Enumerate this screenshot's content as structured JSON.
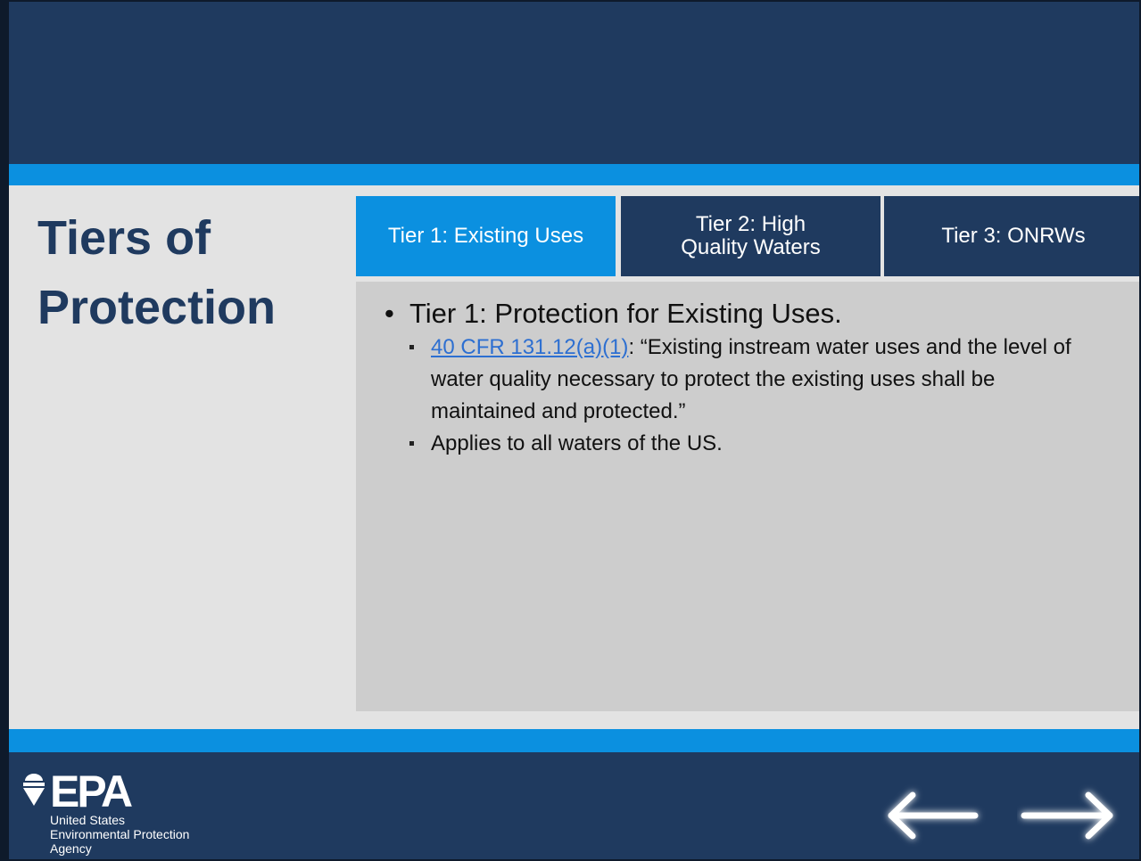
{
  "slide": {
    "title_line1": "Tiers of",
    "title_line2": "Protection"
  },
  "tabs": [
    {
      "label": "Tier 1: Existing Uses",
      "active": true
    },
    {
      "label": "Tier 2: High\nQuality Waters",
      "active": false
    },
    {
      "label": "Tier 3: ONRWs",
      "active": false
    }
  ],
  "content": {
    "main_bullet": "Tier 1: Protection for Existing Uses.",
    "sub_bullet_1_link": "40 CFR 131.12(a)(1)",
    "sub_bullet_1_text": ": “Existing instream water uses and the level of water quality necessary to protect the existing uses shall be maintained and protected.”",
    "sub_bullet_2_text": "Applies to all waters of the US."
  },
  "logo": {
    "wordmark": "EPA",
    "line1": "United States",
    "line2": "Environmental Protection",
    "line3": "Agency"
  },
  "navigation": {
    "prev_icon": "left-arrow-icon",
    "next_icon": "right-arrow-icon"
  },
  "colors": {
    "navy": "#1f3a5f",
    "accent_blue": "#0b90e0",
    "panel_gray": "#cdcdcd",
    "link_blue": "#2d6fd1"
  }
}
